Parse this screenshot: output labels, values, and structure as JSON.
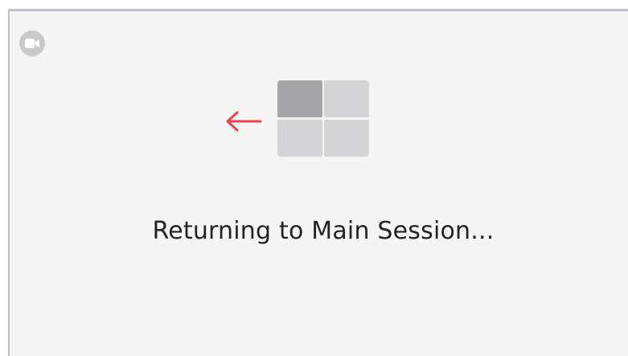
{
  "app": {
    "icon": "video-camera-icon",
    "badge_color": "#c9c9cc"
  },
  "transition": {
    "direction_icon": "arrow-left-icon",
    "arrow_color": "#e8444a",
    "layout_icon": "grid-layout-icon",
    "highlighted_tile_color": "#a5a5a8",
    "tile_color": "#d4d4d6"
  },
  "status": {
    "message": "Returning to Main Session..."
  }
}
